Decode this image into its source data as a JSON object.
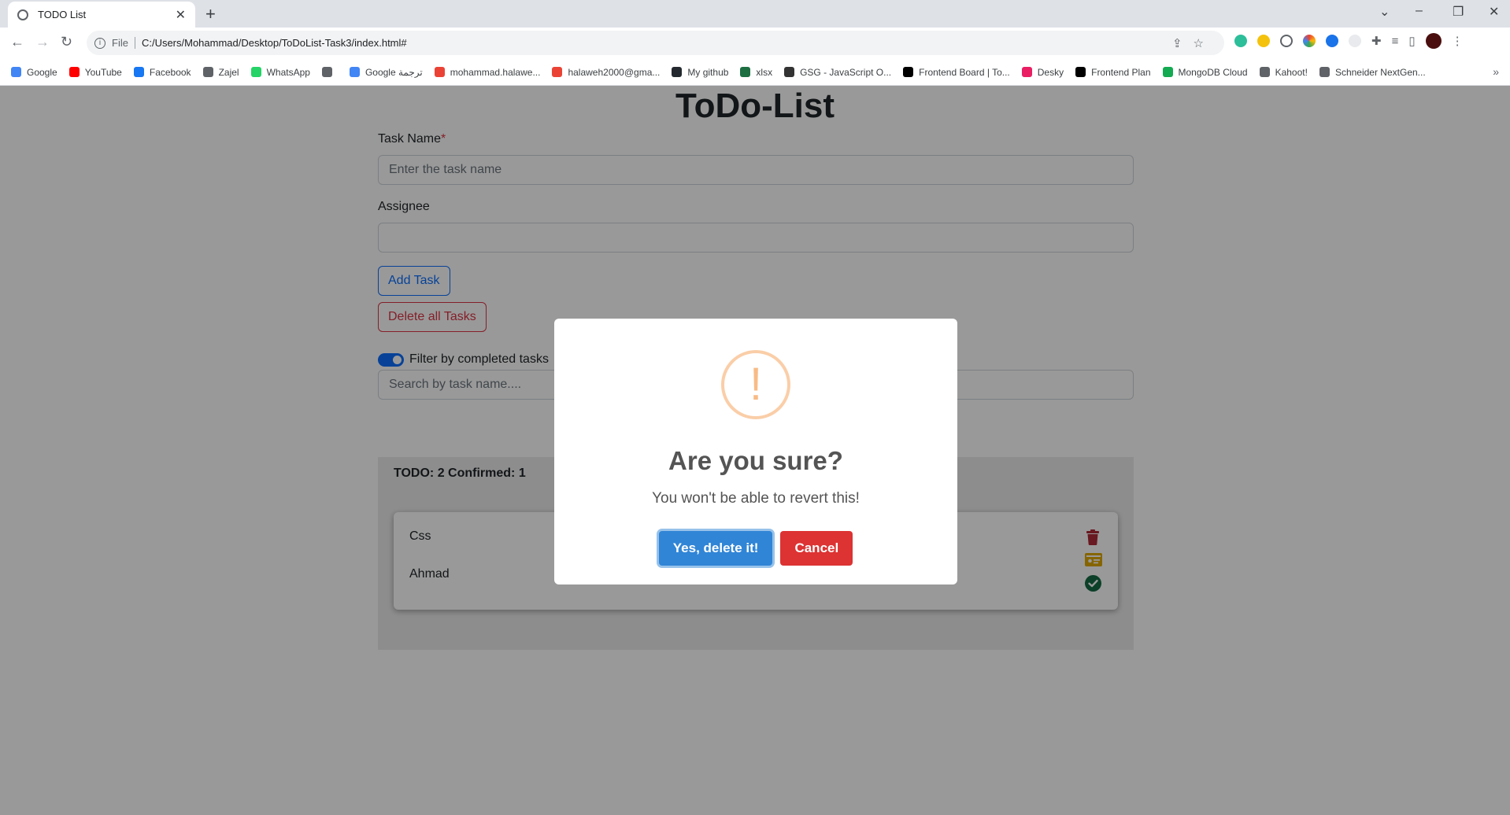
{
  "browser": {
    "tab_title": "TODO List",
    "tab_close": "✕",
    "new_tab": "+",
    "omnibox_scheme": "File",
    "omnibox_url": "C:/Users/Mohammad/Desktop/ToDoList-Task3/index.html#",
    "bookmarks": [
      {
        "label": "Google",
        "color": "#4285f4"
      },
      {
        "label": "YouTube",
        "color": "#ff0000"
      },
      {
        "label": "Facebook",
        "color": "#1877f2"
      },
      {
        "label": "Zajel",
        "color": "#5f6368"
      },
      {
        "label": "WhatsApp",
        "color": "#25d366"
      },
      {
        "label": "",
        "color": "#5f6368"
      },
      {
        "label": "Google ترجمة",
        "color": "#4285f4"
      },
      {
        "label": "mohammad.halawe...",
        "color": "#ea4335"
      },
      {
        "label": "halaweh2000@gma...",
        "color": "#ea4335"
      },
      {
        "label": "My github",
        "color": "#24292f"
      },
      {
        "label": "xlsx",
        "color": "#1d6f42"
      },
      {
        "label": "GSG - JavaScript O...",
        "color": "#333333"
      },
      {
        "label": "Frontend Board | To...",
        "color": "#000000"
      },
      {
        "label": "Desky",
        "color": "#e91e63"
      },
      {
        "label": "Frontend Plan",
        "color": "#000000"
      },
      {
        "label": "MongoDB Cloud",
        "color": "#13aa52"
      },
      {
        "label": "Kahoot!",
        "color": "#5f6368"
      },
      {
        "label": "Schneider NextGen...",
        "color": "#5f6368"
      }
    ],
    "bookmarks_more": "»"
  },
  "form": {
    "title": "ToDo-List",
    "task_name_label": "Task Name",
    "required_mark": "*",
    "task_name_placeholder": "Enter the task name",
    "assignee_label": "Assignee",
    "assignee_value": "",
    "add_task_label": "Add Task",
    "delete_all_label": "Delete all Tasks",
    "search_placeholder": "Search by task name....",
    "filter_label": "Filter by completed tasks",
    "filter_enabled": true
  },
  "list": {
    "counter": "TODO: 2 Confirmed: 1",
    "tasks": [
      {
        "name": "Css",
        "assignee": "Ahmad"
      }
    ]
  },
  "modal": {
    "icon": "!",
    "title": "Are you sure?",
    "text": "You won't be able to revert this!",
    "confirm_label": "Yes, delete it!",
    "cancel_label": "Cancel"
  },
  "colors": {
    "primary": "#0d6efd",
    "danger": "#dc3545",
    "confirm": "#3085d6",
    "cancel": "#dd3333",
    "warning_icon": "#f8bb86",
    "trash_icon": "#b02a37",
    "card_icon": "#e0a800",
    "check_icon": "#146c43"
  }
}
